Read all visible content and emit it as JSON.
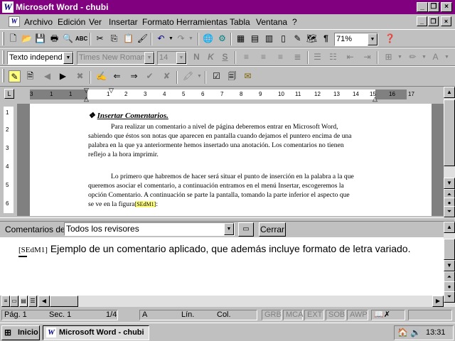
{
  "window": {
    "title": "Microsoft Word - chubi",
    "app_icon": "W"
  },
  "menu": [
    "Archivo",
    "Edición",
    "Ver",
    "Insertar",
    "Formato",
    "Herramientas",
    "Tabla",
    "Ventana",
    "?"
  ],
  "standard_toolbar": {
    "zoom": "71%"
  },
  "format_toolbar": {
    "style": "Texto independ",
    "font": "Times New Roman",
    "size": "14"
  },
  "ruler": {
    "ticks": [
      "3",
      "1",
      "1",
      "1",
      "2",
      "3",
      "4",
      "5",
      "6",
      "7",
      "8",
      "9",
      "10",
      "11",
      "12",
      "13",
      "14",
      "15",
      "16",
      "17"
    ]
  },
  "vruler": {
    "ticks": [
      "1",
      "2",
      "3",
      "4",
      "5",
      "6"
    ]
  },
  "document": {
    "heading_bullet": "❖",
    "heading": "Insertar Comentarios.",
    "p1_lines": [
      "Para realizar un comentario a nivel de página deberemos entrar en Microsoft Word,",
      "sabiendo que éstos son notas que aparecen en pantalla cuando dejamos el puntero encima de una",
      "palabra en la que ya anteriormente hemos insertado una anotación. Los comentarios no tienen",
      "reflejo a la hora imprimir."
    ],
    "p2_lines": [
      "Lo primero que habremos de hacer será situar el punto de inserción en la palabra a la que",
      "queremos asociar el comentario, a continuación entramos en el menú Insertar, escogeremos la",
      "opción Comentario. A continuación se parte la pantalla, tomando la parte inferior el aspecto que",
      "se ve en la figura"
    ],
    "p2_tail": ":",
    "comment_ref": "[SEdM1]"
  },
  "comments_pane": {
    "label": "Comentarios de:",
    "reviewer": "Todos los revisores",
    "close_button": "Cerrar",
    "mark": "[SEdM1]",
    "text": "Ejemplo de un comentario aplicado, que además incluye formato de letra variado."
  },
  "statusbar": {
    "page": "Pág. 1",
    "section": "Sec. 1",
    "pages": "1/4",
    "at": "A",
    "line": "Lín.",
    "col": "Col.",
    "rec": "GRB",
    "trk": "MCA",
    "ext": "EXT",
    "ovr": "SOB",
    "wph": "AWP"
  },
  "taskbar": {
    "start": "Inicio",
    "task": "Microsoft Word - chubi",
    "clock": "13:31"
  },
  "colors": {
    "titlebar": "#800080",
    "face": "#c0c0c0",
    "comment_highlight": "#ffff80"
  }
}
